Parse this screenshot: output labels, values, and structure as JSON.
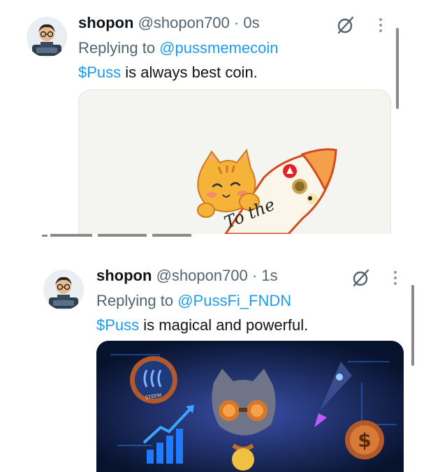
{
  "posts": [
    {
      "author_name": "shopon",
      "author_handle": "@shopon700",
      "separator": "·",
      "time": "0s",
      "reply_prefix": "Replying to",
      "reply_to": "@pussmemecoin",
      "tag": "$Puss",
      "body": " is always best coin.",
      "media_caption": "To the",
      "icons": [
        "avatar",
        "grok-icon",
        "more-icon"
      ]
    },
    {
      "author_name": "shopon",
      "author_handle": "@shopon700",
      "separator": "·",
      "time": "1s",
      "reply_prefix": "Replying to",
      "reply_to": "@PussFi_FNDN",
      "tag": "$Puss",
      "body": " is magical and powerful.",
      "media_caption": "STEEM",
      "icons": [
        "avatar",
        "grok-icon",
        "more-icon"
      ]
    }
  ],
  "colors": {
    "link": "#1d9bf0",
    "secondary_text": "#536471",
    "primary_text": "#0f1419"
  }
}
